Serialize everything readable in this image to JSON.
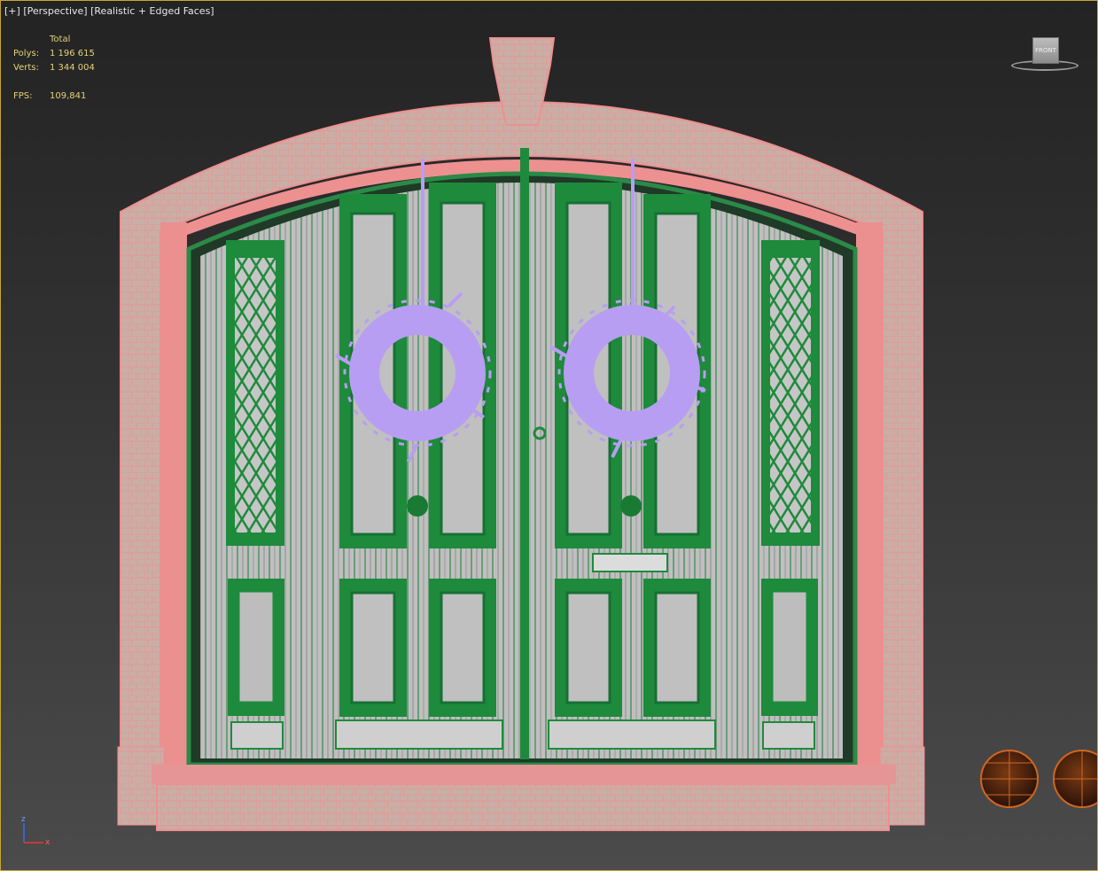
{
  "viewport": {
    "label_plus": "[+]",
    "label_view": "[Perspective]",
    "label_shading": "[Realistic + Edged Faces]"
  },
  "stats": {
    "header": "Total",
    "polys_label": "Polys:",
    "polys_value": "1 196 615",
    "verts_label": "Verts:",
    "verts_value": "1 344 004",
    "fps_label": "FPS:",
    "fps_value": "109,841"
  },
  "viewcube": {
    "face_label": "FRONT"
  },
  "axis_gizmo": {
    "z": "z",
    "x": "x"
  },
  "scene": {
    "objects": [
      "stone-arch",
      "keystone",
      "door-frame",
      "left-door",
      "right-door",
      "left-wreath",
      "right-wreath",
      "doorstep",
      "light-spheres"
    ],
    "colors": {
      "stone_wire": "#ef8f8f",
      "stone_fill": "#cdb6ac",
      "door_green": "#1e8a3c",
      "wood": "#c8c8c8",
      "wreath": "#b79ef2",
      "sphere": "#c0601c",
      "stats_text": "#e6d27a",
      "border": "#c8a437"
    }
  }
}
